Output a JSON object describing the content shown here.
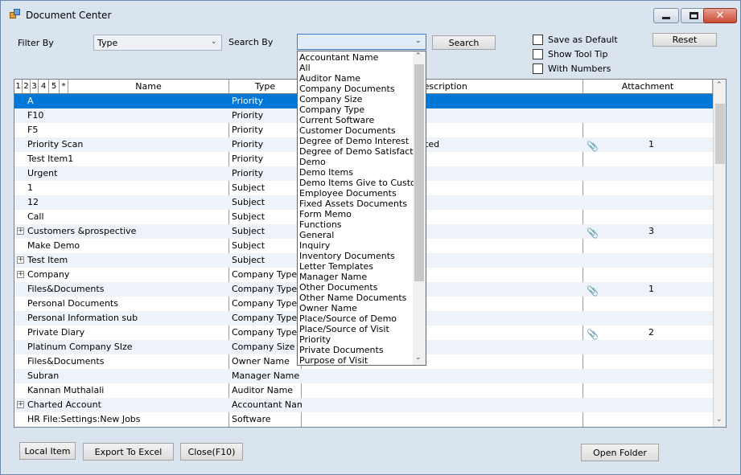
{
  "window": {
    "title": "Document Center",
    "min_icon": "minimize-icon",
    "max_icon": "maximize-icon",
    "close_icon": "close-icon"
  },
  "filter": {
    "filter_by_label": "Filter By",
    "filter_by_value": "Type",
    "search_by_label": "Search By",
    "search_by_value": "",
    "search_button": "Search",
    "reset_button": "Reset"
  },
  "options": {
    "save_as_default": "Save as Default",
    "show_tool_tip": "Show Tool Tip",
    "with_numbers": "With Numbers"
  },
  "grid": {
    "group_numbers": [
      "1",
      "2",
      "3",
      "4",
      "5",
      "*"
    ],
    "headers": {
      "name": "Name",
      "type": "Type",
      "description": "Description",
      "attachment": "Attachment"
    },
    "rows": [
      {
        "name": "A",
        "type": "Priority",
        "description": "",
        "attachment": "",
        "selected": true
      },
      {
        "name": "F10",
        "type": "Priority",
        "description": "",
        "attachment": ""
      },
      {
        "name": "F5",
        "type": "Priority",
        "description": "",
        "attachment": ""
      },
      {
        "name": "Priority Scan",
        "type": "Priority",
        "description": "ted",
        "attachment": "1"
      },
      {
        "name": "Test Item1",
        "type": "Priority",
        "description": "",
        "attachment": ""
      },
      {
        "name": "Urgent",
        "type": "Priority",
        "description": "",
        "attachment": ""
      },
      {
        "name": "1",
        "type": "Subject",
        "description": "",
        "attachment": ""
      },
      {
        "name": "12",
        "type": "Subject",
        "description": "",
        "attachment": ""
      },
      {
        "name": "Call",
        "type": "Subject",
        "description": "",
        "attachment": ""
      },
      {
        "name": "Customers &prospective",
        "type": "Subject",
        "description": "",
        "attachment": "3",
        "expandable": true
      },
      {
        "name": "Make Demo",
        "type": "Subject",
        "description": "",
        "attachment": ""
      },
      {
        "name": "Test Item",
        "type": "Subject",
        "description": "",
        "attachment": "",
        "expandable": true
      },
      {
        "name": "Company",
        "type": "Company Type",
        "description": "",
        "attachment": "",
        "expandable": true
      },
      {
        "name": "Files&Documents",
        "type": "Company Type",
        "description": "",
        "attachment": "1"
      },
      {
        "name": "Personal Documents",
        "type": "Company Type",
        "description": "",
        "attachment": ""
      },
      {
        "name": "Personal Information sub",
        "type": "Company Type",
        "description": "",
        "attachment": ""
      },
      {
        "name": "Private Diary",
        "type": "Company Type",
        "description": "",
        "attachment": "2"
      },
      {
        "name": "Platinum Company SIze",
        "type": "Company Size",
        "description": "",
        "attachment": ""
      },
      {
        "name": "Files&Documents",
        "type": "Owner Name",
        "description": "",
        "attachment": ""
      },
      {
        "name": "Subran",
        "type": "Manager Name",
        "description": "",
        "attachment": ""
      },
      {
        "name": "Kannan Muthalali",
        "type": "Auditor Name",
        "description": "",
        "attachment": ""
      },
      {
        "name": "Charted Account",
        "type": "Accountant Name",
        "description": "",
        "attachment": "",
        "expandable": true
      },
      {
        "name": "HR File:Settings:New Jobs",
        "type": "Software",
        "description": "",
        "attachment": ""
      }
    ]
  },
  "dropdown": {
    "items": [
      "Accountant Name",
      "All",
      "Auditor Name",
      "Company Documents",
      "Company Size",
      "Company Type",
      "Current Software",
      "Customer Documents",
      "Degree of Demo Interest",
      "Degree of Demo Satisfaction",
      "Demo",
      "Demo Items",
      "Demo Items Give to Customer",
      "Employee Documents",
      "Fixed Assets Documents",
      "Form Memo",
      "Functions",
      "General",
      "Inquiry",
      "Inventory Documents",
      "Letter Templates",
      "Manager Name",
      "Other Documents",
      "Other Name Documents",
      "Owner Name",
      "Place/Source of Demo",
      "Place/Source of Visit",
      "Priority",
      "Private Documents",
      "Purpose of Visit"
    ]
  },
  "footer": {
    "local_item": "Local Item",
    "export_excel": "Export To Excel",
    "close": "Close(F10)",
    "open_folder": "Open Folder"
  },
  "colors": {
    "window_bg": "#dae4ef",
    "selection": "#0078d7",
    "alt_row": "#eef3f9"
  }
}
